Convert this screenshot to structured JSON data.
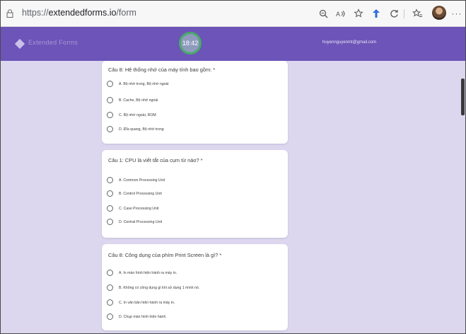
{
  "browser": {
    "url_prefix": "https://",
    "url_domain": "extendedforms.io",
    "url_path": "/form",
    "toolbar_icons": [
      "zoom-icon",
      "read-aloud-icon",
      "favorite-icon",
      "extension-icon",
      "refresh-icon",
      "favorites-bar-icon",
      "profile-avatar",
      "more-icon"
    ]
  },
  "header": {
    "brand": "Extended Forms",
    "timer": "18:42",
    "email": "huyennguyenmt@gmail.com",
    "color": "#6c54b8"
  },
  "questions": [
    {
      "title": "Câu 8: Hệ thống nhớ của máy tính bao gồm: *",
      "options": [
        "A. Bộ nhớ trong, Bộ nhớ ngoài",
        "B. Cache, Bộ nhớ ngoài",
        "C. Bộ nhớ ngoài, ROM",
        "D. Đĩa quang, Bộ nhớ trong"
      ]
    },
    {
      "title": "Câu 1: CPU là viết tắt của cụm từ nào? *",
      "options": [
        "A. Common Processing Unit",
        "B. Control Processing Unit",
        "C. Case Processing Unit",
        "D. Central Processing Unit"
      ]
    },
    {
      "title": "Câu 8: Công dụng của phím Print Screen là gì? *",
      "options": [
        "A. In màn hình hiện hành ra máy in.",
        "B. Không có công dụng gì khi sử dụng 1 mình nó.",
        "C. In văn bản hiện hành ra máy in.",
        "D. Chụp màn hình hiện hành."
      ]
    }
  ]
}
